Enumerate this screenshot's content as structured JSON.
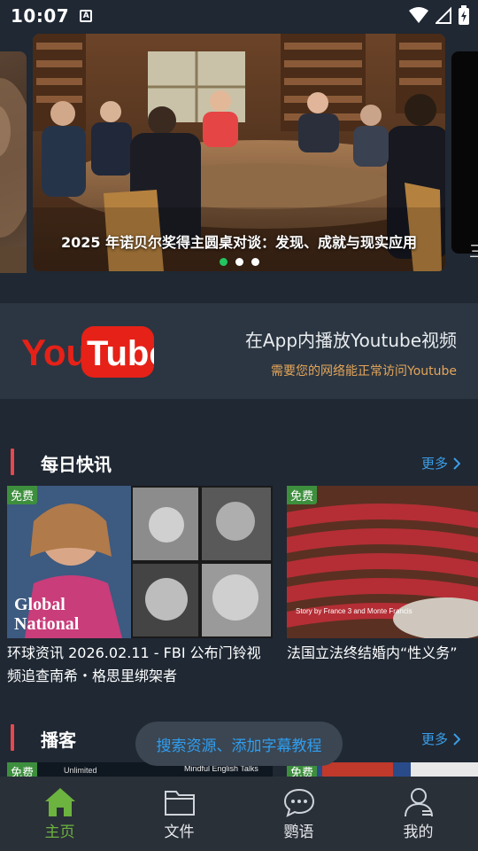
{
  "status_bar": {
    "time": "10:07",
    "badge": "A"
  },
  "carousel": {
    "caption": "2025 年诺贝尔奖得主圆桌对谈：发现、成就与现实应用",
    "right_peek_char": "三",
    "active_dot": 0,
    "dot_count": 3
  },
  "youtube_banner": {
    "logo_you": "You",
    "logo_tube": "Tube",
    "title": "在App内播放Youtube视频",
    "subtitle": "需要您的网络能正常访问Youtube"
  },
  "daily_news": {
    "title": "每日快讯",
    "more": "更多",
    "items": [
      {
        "badge": "免费",
        "title": "环球资讯 2026.02.11 - FBI 公布门铃视频追查南希・格思里绑架者",
        "thumb_text_1": "Global",
        "thumb_text_2": "National"
      },
      {
        "badge": "免费",
        "title": "法国立法终结婚内“性义务”",
        "thumb_text_1": "Story by France 3 and Monte Francis"
      }
    ]
  },
  "podcast": {
    "title": "播客",
    "more": "更多",
    "items": [
      {
        "badge": "免费",
        "thumb_text": "Mindful English Talks",
        "thumb_tag": "Unlimited"
      },
      {
        "badge": "免费"
      }
    ]
  },
  "toast": "搜索资源、添加字幕教程",
  "bottom_nav": [
    {
      "label": "主页",
      "icon": "home-icon",
      "active": true
    },
    {
      "label": "文件",
      "icon": "folder-icon",
      "active": false
    },
    {
      "label": "鹦语",
      "icon": "chat-icon",
      "active": false
    },
    {
      "label": "我的",
      "icon": "profile-icon",
      "active": false
    }
  ],
  "colors": {
    "background": "#1f2833",
    "accent_green": "#6cb33f",
    "link_blue": "#3b9ee8",
    "section_bar_red": "#e5484d",
    "free_badge": "#3d8f3d",
    "youtube_red": "#e62117"
  }
}
